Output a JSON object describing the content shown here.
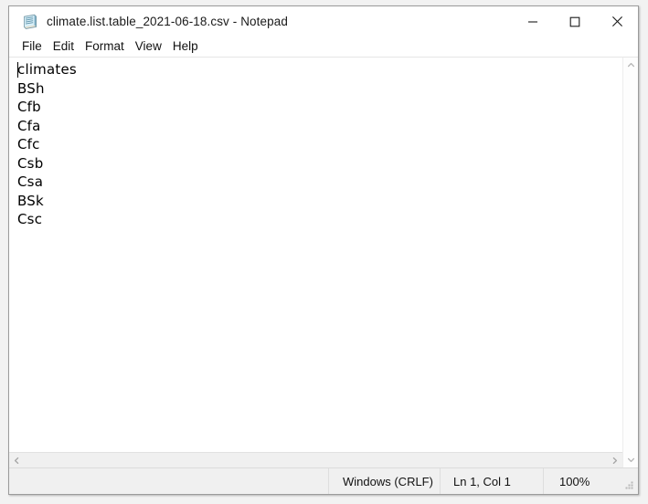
{
  "window": {
    "title": "climate.list.table_2021-06-18.csv - Notepad",
    "app_icon": "notepad-icon",
    "controls": {
      "minimize": "minimize-icon",
      "maximize": "maximize-icon",
      "close": "close-icon"
    }
  },
  "menubar": {
    "items": [
      {
        "label": "File"
      },
      {
        "label": "Edit"
      },
      {
        "label": "Format"
      },
      {
        "label": "View"
      },
      {
        "label": "Help"
      }
    ]
  },
  "editor": {
    "lines": [
      "climates",
      "BSh",
      "Cfb",
      "Cfa",
      "Cfc",
      "Csb",
      "Csa",
      "BSk",
      "Csc"
    ],
    "caret_visible": true
  },
  "scrollbars": {
    "horizontal": {
      "left_arrow": "chevron-left-icon",
      "right_arrow": "chevron-right-icon"
    },
    "vertical": {
      "up_arrow": "chevron-up-icon",
      "down_arrow": "chevron-down-icon"
    }
  },
  "statusbar": {
    "line_ending": "Windows (CRLF)",
    "position": "Ln 1, Col 1",
    "zoom": "100%",
    "grip": "resize-grip-icon"
  },
  "colors": {
    "window_bg": "#ffffff",
    "page_bg": "#f2f2f2",
    "statusbar_bg": "#f0f0f0",
    "border": "#9b9b9b",
    "text": "#000000",
    "icon_body": "#aee0ef"
  }
}
